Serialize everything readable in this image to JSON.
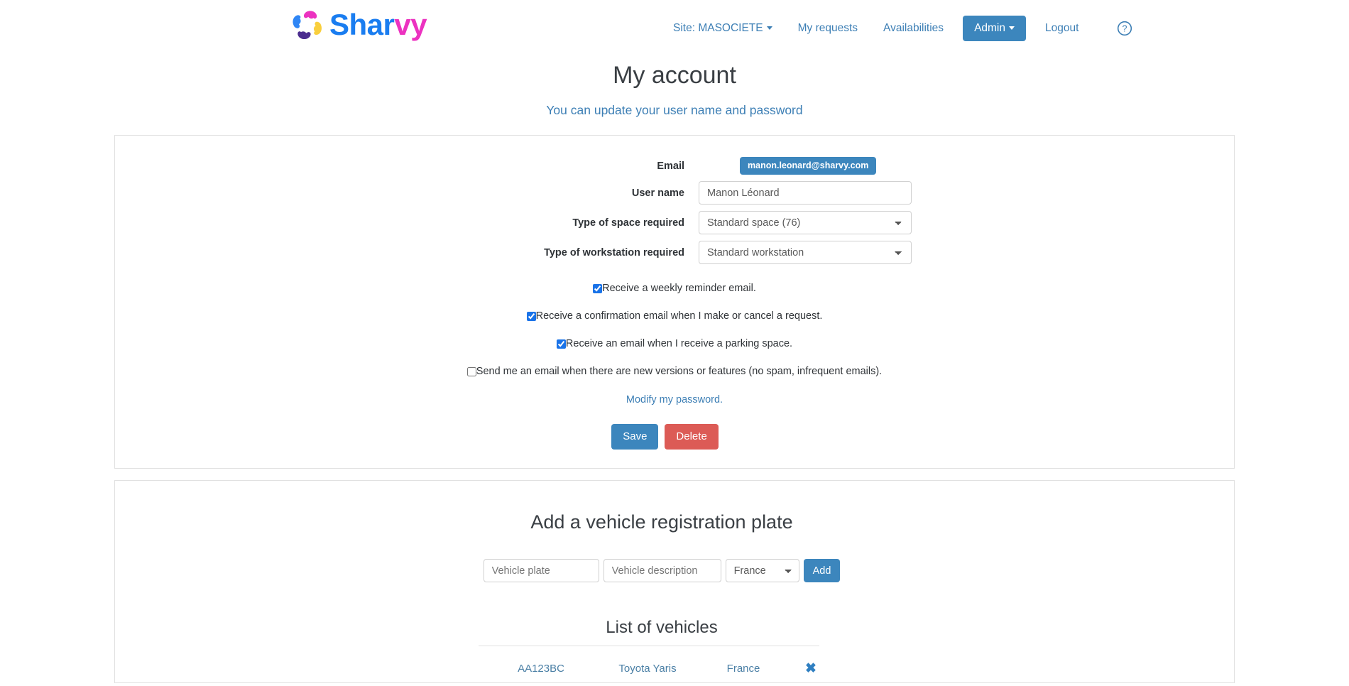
{
  "brand": {
    "name_part1": "Shar",
    "name_part2": "vy",
    "logo_icon": "sharvy-pinwheel-logo",
    "colors": {
      "blue": "#1a7df0",
      "pink": "#ec32c0",
      "yellow": "#f9cf3d",
      "purple": "#4b2d8f"
    }
  },
  "nav": {
    "site_label": "Site: MASOCIETE",
    "my_requests": "My requests",
    "availabilities": "Availabilities",
    "admin": "Admin",
    "logout": "Logout",
    "help_icon": "question-circle-icon",
    "active_color": "#3c86bd"
  },
  "header": {
    "title": "My account",
    "subtitle": "You can update your user name and password"
  },
  "account_form": {
    "email_label": "Email",
    "email_value": "manon.leonard@sharvy.com",
    "username_label": "User name",
    "username_value": "Manon Léonard",
    "space_label": "Type of space required",
    "space_value": "Standard space (76)",
    "space_options": [
      "Standard space (76)"
    ],
    "workstation_label": "Type of workstation required",
    "workstation_value": "Standard workstation",
    "workstation_options": [
      "Standard workstation"
    ],
    "checkboxes": [
      {
        "label": "Receive a weekly reminder email.",
        "checked": true
      },
      {
        "label": "Receive a confirmation email when I make or cancel a request.",
        "checked": true
      },
      {
        "label": "Receive an email when I receive a parking space.",
        "checked": true
      },
      {
        "label": "Send me an email when there are new versions or features (no spam, infrequent emails).",
        "checked": false
      }
    ],
    "password_link": "Modify my password.",
    "save_label": "Save",
    "delete_label": "Delete",
    "save_color": "#3c86bd",
    "delete_color": "#dc5b56"
  },
  "vehicles": {
    "section_title": "Add a vehicle registration plate",
    "plate_placeholder": "Vehicle plate",
    "plate_value": "",
    "description_placeholder": "Vehicle description",
    "description_value": "",
    "country_value": "France",
    "country_options": [
      "France"
    ],
    "add_label": "Add",
    "list_title": "List of vehicles",
    "rows": [
      {
        "plate": "AA123BC",
        "description": "Toyota Yaris",
        "country": "France",
        "delete_icon": "close-x-icon"
      }
    ]
  }
}
